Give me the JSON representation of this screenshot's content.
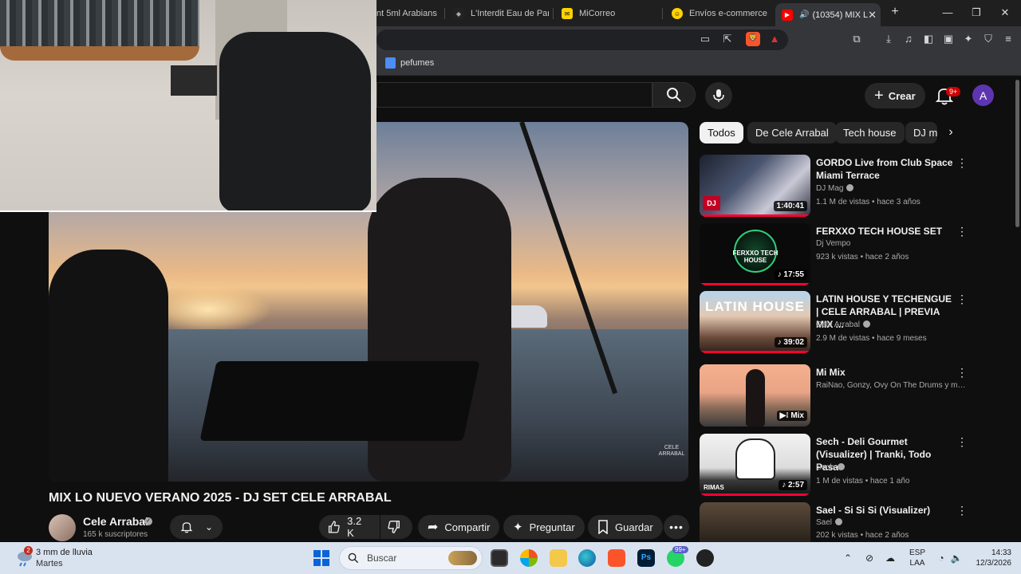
{
  "browser": {
    "tabs": [
      {
        "label": "nt 5ml Arabians",
        "active": false
      },
      {
        "label": "L'Interdit Eau de Parfu",
        "active": false
      },
      {
        "label": "MiCorreo",
        "active": false
      },
      {
        "label": "Envíos e-commerce |",
        "active": false
      },
      {
        "label": "(10354) MIX L",
        "active": true
      }
    ],
    "new_tab": "+",
    "bookmarks": [
      {
        "label": "pefumes"
      }
    ]
  },
  "youtube": {
    "create_label": "Crear",
    "notifications_badge": "9+",
    "avatar_letter": "A",
    "chips": [
      "Todos",
      "De Cele Arrabal",
      "Tech house",
      "DJ m"
    ],
    "video": {
      "title": "MIX LO NUEVO VERANO 2025 - DJ SET CELE ARRABAL",
      "watermark": "CELE ARRABAL",
      "channel": "Cele Arrabal",
      "subscribers": "165 k suscriptores",
      "likes": "3.2 K",
      "share_label": "Compartir",
      "ask_label": "Preguntar",
      "save_label": "Guardar"
    },
    "recommendations": [
      {
        "title": "GORDO Live from Club Space Miami Terrace",
        "channel": "DJ Mag",
        "verified": true,
        "stats": "1.1 M de vistas • hace 3 años",
        "duration": "1:40:41"
      },
      {
        "title": "FERXXO TECH HOUSE SET",
        "channel": "Dj Vempo",
        "verified": false,
        "stats": "923 k vistas • hace 2 años",
        "duration": "17:55",
        "thumb_text": "FERXXO TECH HOUSE"
      },
      {
        "title": "LATIN HOUSE Y TECHENGUE | CELE ARRABAL | PREVIA MIX ...",
        "channel": "Cele Arrabal",
        "verified": true,
        "stats": "2.9 M de vistas • hace 9 meses",
        "duration": "39:02",
        "thumb_text": "LATIN HOUSE"
      },
      {
        "title": "Mi Mix",
        "channel": "RaiNao, Gonzy, Ovy On The Drums y muc...",
        "verified": false,
        "stats": "",
        "duration": "Mix"
      },
      {
        "title": "Sech - Deli Gourmet (Visualizer) | Tranki, Todo Pasa",
        "channel": "Sech",
        "verified": true,
        "stats": "1 M de vistas • hace 1 año",
        "duration": "2:57",
        "thumb_text": "RIMAS"
      },
      {
        "title": "Sael - Si Si Si (Visualizer)",
        "channel": "Sael",
        "verified": true,
        "stats": "202 k vistas • hace 2 años",
        "duration": ""
      }
    ]
  },
  "taskbar": {
    "weather_badge": "2",
    "weather_main": "3 mm de lluvia",
    "weather_sub": "Martes",
    "search_placeholder": "Buscar",
    "whatsapp_badge": "99+",
    "lang_top": "ESP",
    "lang_bottom": "LAA",
    "time": "14:33",
    "date": "12/3/2026"
  }
}
